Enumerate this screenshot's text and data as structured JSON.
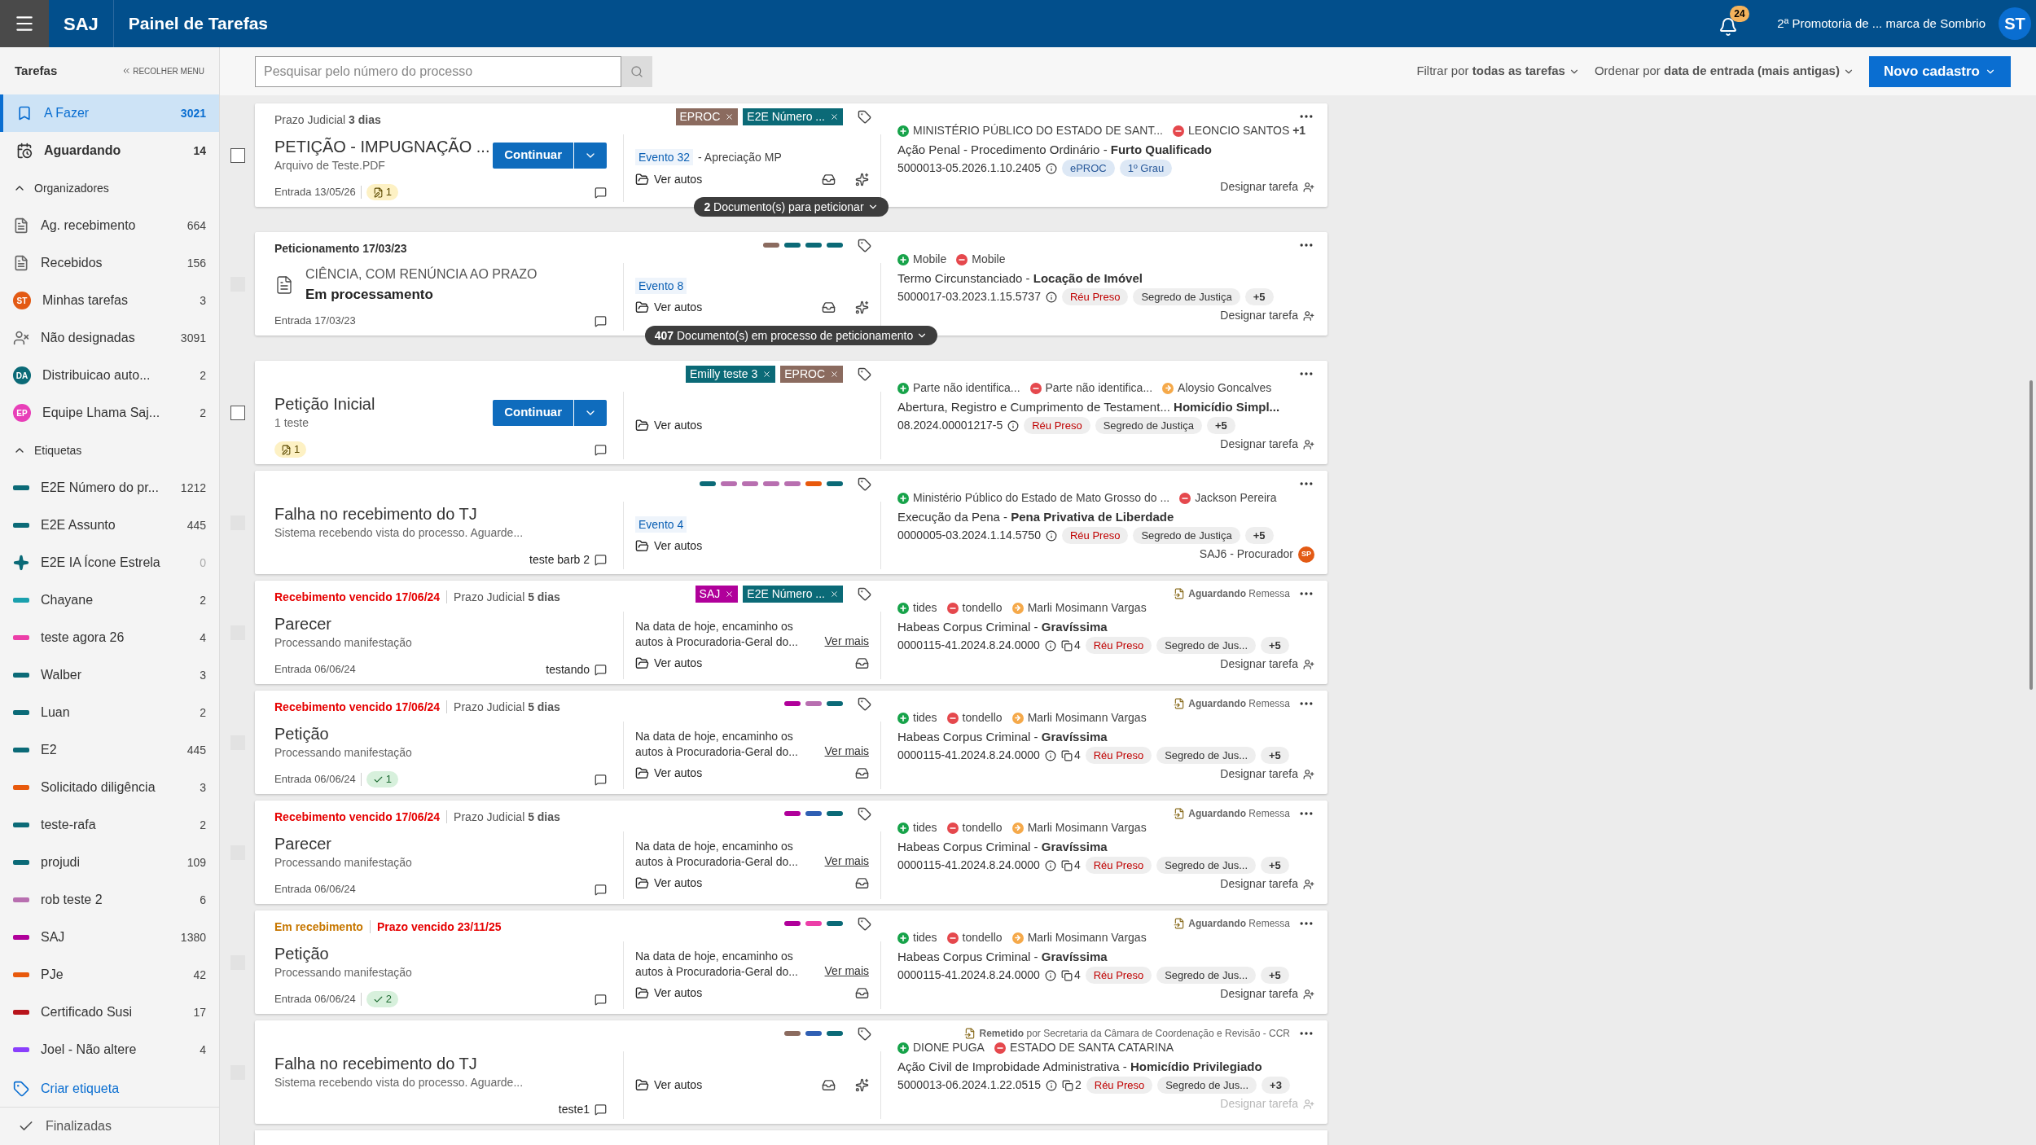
{
  "header": {
    "app": "SAJ",
    "title": "Painel de Tarefas",
    "notifications": "24",
    "organization": "2ª Promotoria de ... marca de Sombrio",
    "user_initials": "ST"
  },
  "toolbar": {
    "search_placeholder": "Pesquisar pelo número do processo",
    "filter": "Filtrar por **todas as tarefas**",
    "sort": "Ordenar por **data de entrada (mais antigas)**",
    "new_button": "Novo cadastro"
  },
  "sidebar": {
    "title": "Tarefas",
    "collapse": "RECOLHER MENU",
    "views": [
      {
        "kind": "todo",
        "label": "A Fazer",
        "count": "3021",
        "selected": true,
        "unread": false
      },
      {
        "kind": "waiting",
        "label": "Aguardando",
        "count": "14",
        "selected": false,
        "unread": true
      }
    ],
    "sections": [
      {
        "title": "Organizadores",
        "expanded": true,
        "items": [
          {
            "kind": "pending",
            "label": "Ag. recebimento",
            "count": "664"
          },
          {
            "kind": "received",
            "label": "Recebidos",
            "count": "156"
          },
          {
            "kind": "avatar",
            "initials": "ST",
            "color": "#e35a14",
            "label": "Minhas tarefas",
            "count": "3"
          },
          {
            "kind": "unassigned",
            "label": "Não designadas",
            "count": "3091"
          },
          {
            "kind": "avatar",
            "initials": "DA",
            "color": "#0b6a77",
            "label": "Distribuicao auto...",
            "count": "2"
          },
          {
            "kind": "avatar",
            "initials": "EP",
            "color": "#e83fb8",
            "label": "Equipe Lhama Saj...",
            "count": "2"
          }
        ]
      },
      {
        "title": "Etiquetas",
        "expanded": true,
        "items": [
          {
            "kind": "bar",
            "color": "#0b6a77",
            "label": "E2E Número do pr...",
            "count": "1212"
          },
          {
            "kind": "bar",
            "color": "#0b6a77",
            "label": "E2E Assunto",
            "count": "445"
          },
          {
            "kind": "star",
            "color": "#0b6a77",
            "label": "E2E IA Ícone Estrela",
            "count": "0"
          },
          {
            "kind": "bar",
            "color": "#1aa0ad",
            "label": "Chayane",
            "count": "2"
          },
          {
            "kind": "bar",
            "color": "#ec3fa8",
            "label": "teste agora 26",
            "count": "4"
          },
          {
            "kind": "bar",
            "color": "#0b6a77",
            "label": "Walber",
            "count": "3"
          },
          {
            "kind": "bar",
            "color": "#0b6a77",
            "label": "Luan",
            "count": "2"
          },
          {
            "kind": "bar",
            "color": "#0b6a77",
            "label": "E2",
            "count": "445"
          },
          {
            "kind": "bar",
            "color": "#e8590c",
            "label": "Solicitado diligência",
            "count": "3"
          },
          {
            "kind": "bar",
            "color": "#0b6a77",
            "label": "teste-rafa",
            "count": "2"
          },
          {
            "kind": "bar",
            "color": "#0b6a77",
            "label": "projudi",
            "count": "109"
          },
          {
            "kind": "bar",
            "color": "#b86fb0",
            "label": "rob teste 2",
            "count": "6"
          },
          {
            "kind": "bar",
            "color": "#b0009a",
            "label": "SAJ",
            "count": "1380"
          },
          {
            "kind": "bar",
            "color": "#e8590c",
            "label": "PJe",
            "count": "42"
          },
          {
            "kind": "bar",
            "color": "#b8141b",
            "label": "Certificado Susi",
            "count": "17"
          },
          {
            "kind": "bar",
            "color": "#8a3ffc",
            "label": "Joel - Não altere",
            "count": "4"
          }
        ]
      }
    ],
    "create_label": "Criar etiqueta",
    "finished": "Finalizadas"
  },
  "cards": [
    {
      "disabled": false,
      "header": [
        {
          "kind": "plain",
          "text": "Prazo Judicial **3 dias**"
        }
      ],
      "tags": [
        {
          "label": "EPROC",
          "color": "#8b6b5f"
        },
        {
          "label": "E2E Número ...",
          "color": "#0b6a77"
        }
      ],
      "kind": "task",
      "title": "PETIÇÃO - IMPUGNAÇÃO ...",
      "subtitle": "Arquivo de Teste.PDF",
      "action": "Continuar",
      "entry": "Entrada 13/05/26",
      "badge": {
        "kind": "draft",
        "count": "1"
      },
      "event": "Evento 32",
      "event_detail": "- Apreciação MP",
      "autos": "Ver autos",
      "receive_tool": true,
      "ai_tool": true,
      "parties": [
        {
          "kind": "active",
          "name": "MINISTÉRIO PÚBLICO DO ESTADO DE SANT..."
        },
        {
          "kind": "passive",
          "name": "LEONCIO SANTOS **+1**"
        }
      ],
      "class": "Ação Penal - Procedimento Ordinário - **Furto Qualificado**",
      "number": "5000013-05.2026.1.10.2405",
      "chips": [
        {
          "kind": "info",
          "label": "ePROC"
        },
        {
          "kind": "info",
          "label": "1º Grau"
        }
      ],
      "assign": {
        "label": "Designar tarefa",
        "disabled": false
      },
      "pill": "**2** Documento(s) para peticionar"
    },
    {
      "disabled": true,
      "header": [
        {
          "kind": "strong",
          "text": "Peticionamento 17/03/23"
        }
      ],
      "bars": [
        {
          "color": "#8b6b5f"
        },
        {
          "color": "#0b6a77"
        },
        {
          "color": "#0b6a77"
        },
        {
          "color": "#0b6a77"
        }
      ],
      "kind": "document",
      "title": "CIÊNCIA, COM RENÚNCIA AO PRAZO",
      "subtitle": "Em processamento",
      "entry": "Entrada 17/03/23",
      "event": "Evento 8",
      "autos": "Ver autos",
      "receive_tool": true,
      "ai_tool": true,
      "parties": [
        {
          "kind": "active",
          "name": "Mobile"
        },
        {
          "kind": "passive",
          "name": "Mobile"
        }
      ],
      "class": "Termo Circunstanciado - **Locação de Imóvel**",
      "number": "5000017-03.2023.1.15.5737",
      "chips": [
        {
          "kind": "alert",
          "label": "Réu Preso"
        },
        {
          "kind": "neutral",
          "label": "Segredo de Justiça"
        },
        {
          "kind": "more",
          "label": "+5"
        }
      ],
      "assign": {
        "label": "Designar tarefa",
        "disabled": false
      },
      "pill": "**407** Documento(s) em processo de peticionamento"
    },
    {
      "disabled": false,
      "tags": [
        {
          "label": "Emilly teste 3",
          "color": "#0b6a77"
        },
        {
          "label": "EPROC",
          "color": "#8b6b5f"
        }
      ],
      "kind": "task",
      "title": "Petição Inicial",
      "subtitle": "1 teste",
      "action": "Continuar",
      "badge": {
        "kind": "draft",
        "count": "1"
      },
      "autos": "Ver autos",
      "receive_tool": false,
      "ai_tool": false,
      "parties": [
        {
          "kind": "active",
          "name": "Parte não identifica..."
        },
        {
          "kind": "passive",
          "name": "Parte não identifica..."
        },
        {
          "kind": "other",
          "name": "Aloysio Goncalves"
        }
      ],
      "class": "Abertura, Registro e Cumprimento de Testament...  **Homicídio Simpl...**",
      "number": "08.2024.00001217-5",
      "chips": [
        {
          "kind": "alert",
          "label": "Réu Preso"
        },
        {
          "kind": "neutral",
          "label": "Segredo de Justiça"
        },
        {
          "kind": "more",
          "label": "+5"
        }
      ],
      "assign": {
        "label": "Designar tarefa",
        "disabled": false
      }
    },
    {
      "disabled": true,
      "bars": [
        {
          "color": "#0b6a77"
        },
        {
          "color": "#b86fb0"
        },
        {
          "color": "#b86fb0"
        },
        {
          "color": "#b86fb0"
        },
        {
          "color": "#b86fb0"
        },
        {
          "color": "#e8590c"
        },
        {
          "color": "#0b6a77"
        }
      ],
      "kind": "task",
      "title": "Falha no recebimento do TJ",
      "subtitle": "Sistema recebendo vista do processo. Aguarde...",
      "comment": "teste barb 2",
      "event": "Evento 4",
      "autos": "Ver autos",
      "receive_tool": false,
      "ai_tool": false,
      "parties": [
        {
          "kind": "active",
          "name": "Ministério Público do Estado de Mato Grosso do ..."
        },
        {
          "kind": "passive",
          "name": "Jackson Pereira"
        }
      ],
      "class": "Execução da Pena - **Pena Privativa de Liberdade**",
      "number": "0000005-03.2024.1.14.5750",
      "chips": [
        {
          "kind": "alert",
          "label": "Réu Preso"
        },
        {
          "kind": "neutral",
          "label": "Segredo de Justiça"
        },
        {
          "kind": "more",
          "label": "+5"
        }
      ],
      "assign": {
        "label": "SAJ6 - Procurador",
        "avatar": "SP"
      }
    },
    {
      "disabled": true,
      "header": [
        {
          "kind": "alert",
          "text": "Recebimento vencido 17/06/24"
        },
        {
          "kind": "plain",
          "text": "Prazo Judicial **5 dias**"
        }
      ],
      "tags": [
        {
          "label": "SAJ",
          "color": "#b0009a"
        },
        {
          "label": "E2E Número ...",
          "color": "#0b6a77"
        }
      ],
      "status": "**Aguardando** Remessa",
      "kind": "task",
      "title": "Parecer",
      "subtitle": "Processando manifestação",
      "entry": "Entrada 06/06/24",
      "comment": "testando",
      "description": "Na data de hoje, encaminho os autos à Procuradoria-Geral do...",
      "more": "Ver mais",
      "autos": "Ver autos",
      "receive_tool": true,
      "ai_tool": false,
      "parties": [
        {
          "kind": "active",
          "name": "tides"
        },
        {
          "kind": "passive",
          "name": "tondello"
        },
        {
          "kind": "other",
          "name": "Marli Mosimann Vargas"
        }
      ],
      "class": "Habeas Corpus Criminal - **Gravíssima**",
      "number": "0000115-41.2024.8.24.0000",
      "attachments": "4",
      "chips": [
        {
          "kind": "alert",
          "label": "Réu Preso"
        },
        {
          "kind": "neutral",
          "label": "Segredo de Jus..."
        },
        {
          "kind": "more",
          "label": "+5"
        }
      ],
      "assign": {
        "label": "Designar tarefa",
        "disabled": false
      }
    },
    {
      "disabled": true,
      "header": [
        {
          "kind": "alert",
          "text": "Recebimento vencido 17/06/24"
        },
        {
          "kind": "plain",
          "text": "Prazo Judicial **5 dias**"
        }
      ],
      "bars": [
        {
          "color": "#b0009a"
        },
        {
          "color": "#b86fb0"
        },
        {
          "color": "#0b6a77"
        }
      ],
      "status": "**Aguardando** Remessa",
      "kind": "task",
      "title": "Petição",
      "subtitle": "Processando manifestação",
      "entry": "Entrada 06/06/24",
      "badge": {
        "kind": "check",
        "count": "1"
      },
      "description": "Na data de hoje, encaminho os autos à Procuradoria-Geral do...",
      "more": "Ver mais",
      "autos": "Ver autos",
      "receive_tool": true,
      "ai_tool": false,
      "parties": [
        {
          "kind": "active",
          "name": "tides"
        },
        {
          "kind": "passive",
          "name": "tondello"
        },
        {
          "kind": "other",
          "name": "Marli Mosimann Vargas"
        }
      ],
      "class": "Habeas Corpus Criminal - **Gravíssima**",
      "number": "0000115-41.2024.8.24.0000",
      "attachments": "4",
      "chips": [
        {
          "kind": "alert",
          "label": "Réu Preso"
        },
        {
          "kind": "neutral",
          "label": "Segredo de Jus..."
        },
        {
          "kind": "more",
          "label": "+5"
        }
      ],
      "assign": {
        "label": "Designar tarefa",
        "disabled": false
      }
    },
    {
      "disabled": true,
      "header": [
        {
          "kind": "alert",
          "text": "Recebimento vencido 17/06/24"
        },
        {
          "kind": "plain",
          "text": "Prazo Judicial **5 dias**"
        }
      ],
      "bars": [
        {
          "color": "#b0009a"
        },
        {
          "color": "#2f5fb3"
        },
        {
          "color": "#0b6a77"
        }
      ],
      "status": "**Aguardando** Remessa",
      "kind": "task",
      "title": "Parecer",
      "subtitle": "Processando manifestação",
      "entry": "Entrada 06/06/24",
      "description": "Na data de hoje, encaminho os autos à Procuradoria-Geral do...",
      "more": "Ver mais",
      "autos": "Ver autos",
      "receive_tool": true,
      "ai_tool": false,
      "parties": [
        {
          "kind": "active",
          "name": "tides"
        },
        {
          "kind": "passive",
          "name": "tondello"
        },
        {
          "kind": "other",
          "name": "Marli Mosimann Vargas"
        }
      ],
      "class": "Habeas Corpus Criminal - **Gravíssima**",
      "number": "0000115-41.2024.8.24.0000",
      "attachments": "4",
      "chips": [
        {
          "kind": "alert",
          "label": "Réu Preso"
        },
        {
          "kind": "neutral",
          "label": "Segredo de Jus..."
        },
        {
          "kind": "more",
          "label": "+5"
        }
      ],
      "assign": {
        "label": "Designar tarefa",
        "disabled": false
      }
    },
    {
      "disabled": true,
      "header": [
        {
          "kind": "warning",
          "text": "Em recebimento"
        },
        {
          "kind": "alert",
          "text": "Prazo vencido 23/11/25"
        }
      ],
      "bars": [
        {
          "color": "#b0009a"
        },
        {
          "color": "#ec3fa8"
        },
        {
          "color": "#0b6a77"
        }
      ],
      "status": "**Aguardando** Remessa",
      "kind": "task",
      "title": "Petição",
      "subtitle": "Processando manifestação",
      "entry": "Entrada 06/06/24",
      "badge": {
        "kind": "check",
        "count": "2"
      },
      "description": "Na data de hoje, encaminho os autos à Procuradoria-Geral do...",
      "more": "Ver mais",
      "autos": "Ver autos",
      "receive_tool": true,
      "ai_tool": false,
      "parties": [
        {
          "kind": "active",
          "name": "tides"
        },
        {
          "kind": "passive",
          "name": "tondello"
        },
        {
          "kind": "other",
          "name": "Marli Mosimann Vargas"
        }
      ],
      "class": "Habeas Corpus Criminal - **Gravíssima**",
      "number": "0000115-41.2024.8.24.0000",
      "attachments": "4",
      "chips": [
        {
          "kind": "alert",
          "label": "Réu Preso"
        },
        {
          "kind": "neutral",
          "label": "Segredo de Jus..."
        },
        {
          "kind": "more",
          "label": "+5"
        }
      ],
      "assign": {
        "label": "Designar tarefa",
        "disabled": false
      }
    },
    {
      "disabled": true,
      "bars": [
        {
          "color": "#8b6b5f"
        },
        {
          "color": "#2f5fb3"
        },
        {
          "color": "#0b6a77"
        }
      ],
      "status": "**Remetido** por Secretaria da Câmara de Coordenação e Revisão - CCR",
      "kind": "task",
      "title": "Falha no recebimento do TJ",
      "subtitle": "Sistema recebendo vista do processo. Aguarde...",
      "comment": "teste1",
      "autos": "Ver autos",
      "receive_tool": true,
      "ai_tool": true,
      "parties": [
        {
          "kind": "active",
          "name": "DIONE PUGA"
        },
        {
          "kind": "passive",
          "name": "ESTADO DE SANTA CATARINA"
        }
      ],
      "class": "Ação Civil de Improbidade Administrativa - **Homicídio Privilegiado**",
      "number": "5000013-06.2024.1.22.0515",
      "attachments": "2",
      "chips": [
        {
          "kind": "alert",
          "label": "Réu Preso"
        },
        {
          "kind": "neutral",
          "label": "Segredo de Jus..."
        },
        {
          "kind": "more",
          "label": "+3"
        }
      ],
      "assign": {
        "label": "Designar tarefa",
        "disabled": true
      }
    }
  ]
}
